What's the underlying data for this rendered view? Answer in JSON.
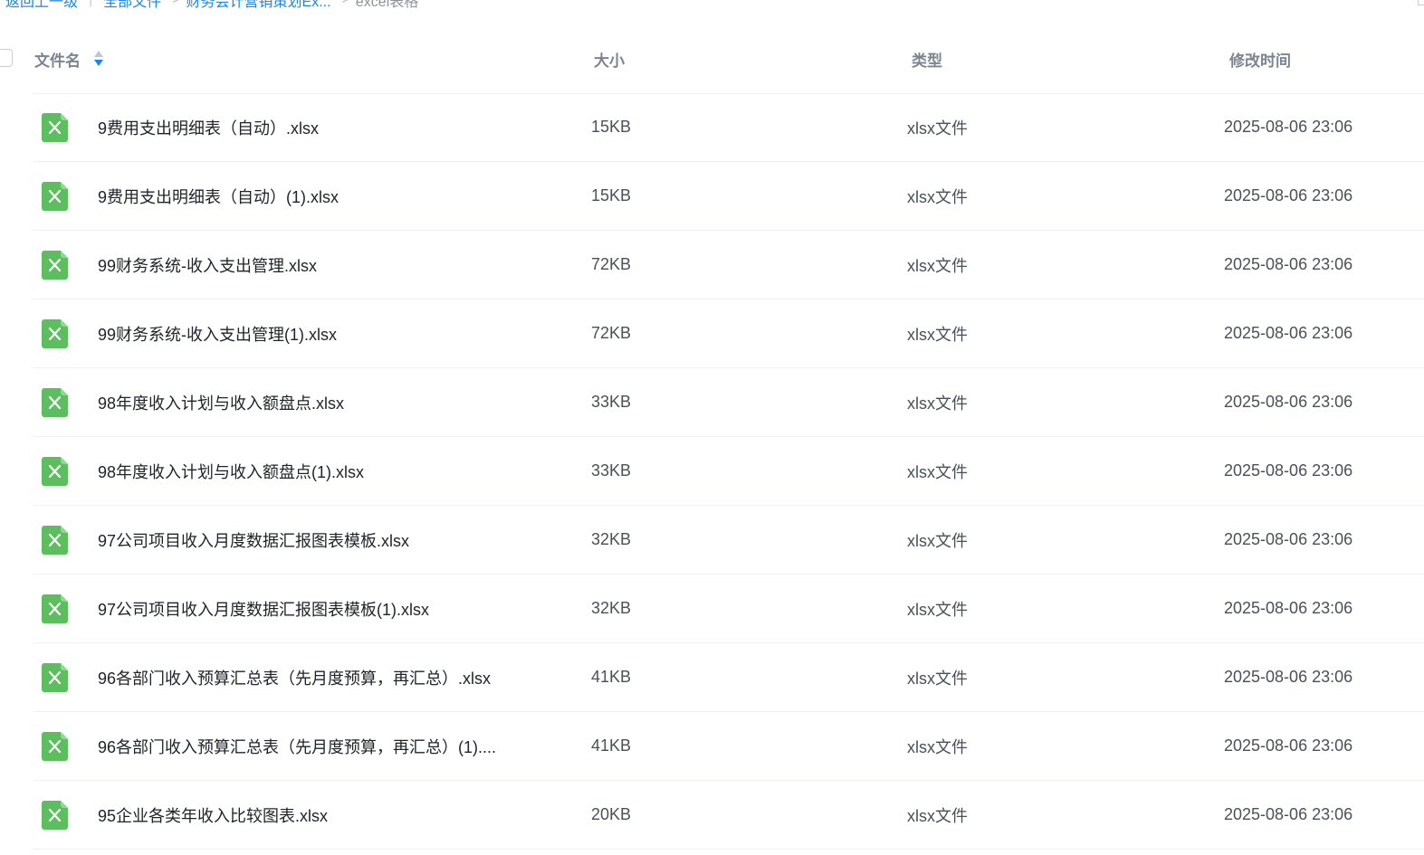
{
  "breadcrumb": {
    "back": "返回上一级",
    "bar": "|",
    "root": "全部文件",
    "sep": ">",
    "parent": "财务会计营销策划Ex...",
    "current": "excel表格"
  },
  "table": {
    "headers": {
      "name": "文件名",
      "size": "大小",
      "type": "类型",
      "time": "修改时间"
    },
    "sort": {
      "column": "name",
      "direction": "desc"
    },
    "icon": "excel-file-icon",
    "icon_color": "#5cbe5e",
    "accent_color": "#1a86ee",
    "rows": [
      {
        "name": "9费用支出明细表（自动）.xlsx",
        "size": "15KB",
        "type": "xlsx文件",
        "time": "2025-08-06 23:06"
      },
      {
        "name": "9费用支出明细表（自动）(1).xlsx",
        "size": "15KB",
        "type": "xlsx文件",
        "time": "2025-08-06 23:06"
      },
      {
        "name": "99财务系统-收入支出管理.xlsx",
        "size": "72KB",
        "type": "xlsx文件",
        "time": "2025-08-06 23:06"
      },
      {
        "name": "99财务系统-收入支出管理(1).xlsx",
        "size": "72KB",
        "type": "xlsx文件",
        "time": "2025-08-06 23:06"
      },
      {
        "name": "98年度收入计划与收入额盘点.xlsx",
        "size": "33KB",
        "type": "xlsx文件",
        "time": "2025-08-06 23:06"
      },
      {
        "name": "98年度收入计划与收入额盘点(1).xlsx",
        "size": "33KB",
        "type": "xlsx文件",
        "time": "2025-08-06 23:06"
      },
      {
        "name": "97公司项目收入月度数据汇报图表模板.xlsx",
        "size": "32KB",
        "type": "xlsx文件",
        "time": "2025-08-06 23:06"
      },
      {
        "name": "97公司项目收入月度数据汇报图表模板(1).xlsx",
        "size": "32KB",
        "type": "xlsx文件",
        "time": "2025-08-06 23:06"
      },
      {
        "name": "96各部门收入预算汇总表（先月度预算，再汇总）.xlsx",
        "size": "41KB",
        "type": "xlsx文件",
        "time": "2025-08-06 23:06"
      },
      {
        "name": "96各部门收入预算汇总表（先月度预算，再汇总）(1)....",
        "size": "41KB",
        "type": "xlsx文件",
        "time": "2025-08-06 23:06"
      },
      {
        "name": "95企业各类年收入比较图表.xlsx",
        "size": "20KB",
        "type": "xlsx文件",
        "time": "2025-08-06 23:06"
      }
    ]
  }
}
